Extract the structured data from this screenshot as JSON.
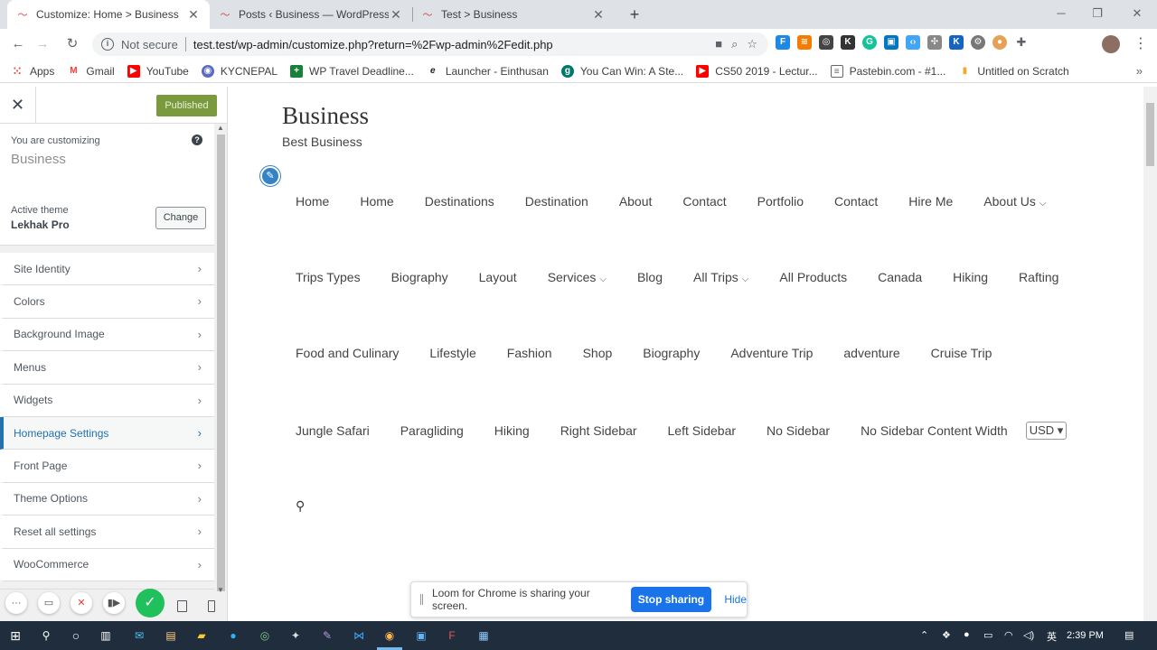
{
  "browser": {
    "tabs": [
      {
        "title": "Customize: Home > Business",
        "active": true
      },
      {
        "title": "Posts ‹ Business — WordPress",
        "active": false
      },
      {
        "title": "Test > Business",
        "active": false
      }
    ],
    "not_secure": "Not secure",
    "url": "test.test/wp-admin/customize.php?return=%2Fwp-admin%2Fedit.php",
    "bookmarks": [
      {
        "label": "Apps",
        "icon": "apps-grid-icon",
        "color": "#ea4335"
      },
      {
        "label": "Gmail",
        "icon": "gmail-icon",
        "color": "#ea4335"
      },
      {
        "label": "YouTube",
        "icon": "youtube-icon",
        "color": "#ff0000"
      },
      {
        "label": "KYCNEPAL",
        "icon": "kycnepal-icon",
        "color": "#5c6bc0"
      },
      {
        "label": "WP Travel Deadline...",
        "icon": "sheets-icon",
        "color": "#188038"
      },
      {
        "label": "Launcher - Einthusan",
        "icon": "einthusan-icon",
        "color": "#222222"
      },
      {
        "label": "You Can Win: A Ste...",
        "icon": "goodreads-icon",
        "color": "#00796b"
      },
      {
        "label": "CS50 2019 - Lectur...",
        "icon": "youtube-icon",
        "color": "#ff0000"
      },
      {
        "label": "Pastebin.com - #1...",
        "icon": "pastebin-icon",
        "color": "#666666"
      },
      {
        "label": "Untitled on Scratch",
        "icon": "scratch-icon",
        "color": "#f9a825"
      }
    ]
  },
  "customizer": {
    "published_label": "Published",
    "customizing_label": "You are customizing",
    "site_name": "Business",
    "active_theme_label": "Active theme",
    "theme_name": "Lekhak Pro",
    "change_label": "Change",
    "menu": [
      {
        "label": "Site Identity",
        "active": false
      },
      {
        "label": "Colors",
        "active": false
      },
      {
        "label": "Background Image",
        "active": false
      },
      {
        "label": "Menus",
        "active": false
      },
      {
        "label": "Widgets",
        "active": false
      },
      {
        "label": "Homepage Settings",
        "active": true
      },
      {
        "label": "Front Page",
        "active": false
      },
      {
        "label": "Theme Options",
        "active": false
      },
      {
        "label": "Reset all settings",
        "active": false
      },
      {
        "label": "WooCommerce",
        "active": false
      }
    ],
    "accent_color": "#2271b1",
    "published_color": "#7a9a3d"
  },
  "preview": {
    "site_title": "Business",
    "site_tagline": "Best Business",
    "nav_rows": [
      [
        {
          "label": "Home"
        },
        {
          "label": "Home"
        },
        {
          "label": "Destinations"
        },
        {
          "label": "Destination"
        },
        {
          "label": "About"
        },
        {
          "label": "Contact"
        },
        {
          "label": "Portfolio"
        },
        {
          "label": "Contact"
        },
        {
          "label": "Hire Me"
        },
        {
          "label": "About Us",
          "dropdown": true
        }
      ],
      [
        {
          "label": "Trips Types"
        },
        {
          "label": "Biography"
        },
        {
          "label": "Layout"
        },
        {
          "label": "Services",
          "dropdown": true
        },
        {
          "label": "Blog"
        },
        {
          "label": "All Trips",
          "dropdown": true
        },
        {
          "label": "All Products"
        },
        {
          "label": "Canada"
        },
        {
          "label": "Hiking"
        },
        {
          "label": "Rafting"
        }
      ],
      [
        {
          "label": "Food and Culinary"
        },
        {
          "label": "Lifestyle"
        },
        {
          "label": "Fashion"
        },
        {
          "label": "Shop"
        },
        {
          "label": "Biography"
        },
        {
          "label": "Adventure Trip"
        },
        {
          "label": "adventure"
        },
        {
          "label": "Cruise Trip"
        }
      ],
      [
        {
          "label": "Jungle Safari"
        },
        {
          "label": "Paragliding"
        },
        {
          "label": "Hiking"
        },
        {
          "label": "Right Sidebar"
        },
        {
          "label": "Left Sidebar"
        },
        {
          "label": "No Sidebar"
        },
        {
          "label": "No Sidebar Content Width"
        }
      ]
    ],
    "currency": "USD"
  },
  "loom": {
    "message": "Loom for Chrome is sharing your screen.",
    "stop_label": "Stop sharing",
    "hide_label": "Hide"
  },
  "taskbar": {
    "time": "2:39 PM"
  }
}
